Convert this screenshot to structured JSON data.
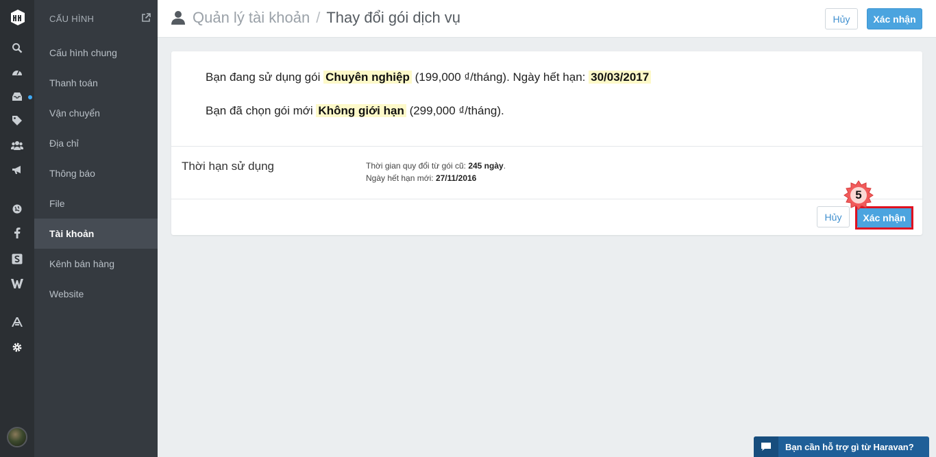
{
  "sidebar": {
    "header": "CẤU HÌNH",
    "items": [
      {
        "label": "Cấu hình chung"
      },
      {
        "label": "Thanh toán"
      },
      {
        "label": "Vận chuyển"
      },
      {
        "label": "Địa chỉ"
      },
      {
        "label": "Thông báo"
      },
      {
        "label": "File"
      },
      {
        "label": "Tài khoản",
        "active": true
      },
      {
        "label": "Kênh bán hàng"
      },
      {
        "label": "Website"
      }
    ]
  },
  "rail": {
    "icons": [
      "logo-icon",
      "search-icon",
      "dashboard-icon",
      "inbox-icon",
      "tags-icon",
      "users-icon",
      "megaphone-icon",
      "globe-icon",
      "facebook-icon",
      "s-app-icon",
      "w-app-icon",
      "apps-icon",
      "gear-icon"
    ]
  },
  "topbar": {
    "breadcrumb_parent": "Quản lý tài khoản",
    "breadcrumb_separator": "/",
    "breadcrumb_current": "Thay đổi gói dịch vụ",
    "cancel_label": "Hủy",
    "confirm_label": "Xác nhận"
  },
  "plan": {
    "current_prefix": "Bạn đang sử dụng gói",
    "current_name": "Chuyên nghiệp",
    "current_price": "(199,000 ₫/tháng). Ngày hết hạn:",
    "current_expiry": "30/03/2017",
    "new_prefix": "Bạn đã chọn gói mới",
    "new_name": "Không giới hạn",
    "new_price": "(299,000 ₫/tháng)."
  },
  "term": {
    "label": "Thời hạn sử dụng",
    "convert_prefix": "Thời gian quy đổi từ gói cũ:",
    "convert_value": "245 ngày",
    "convert_suffix": ".",
    "expiry_prefix": "Ngày hết hạn mới:",
    "expiry_value": "27/11/2016"
  },
  "footer": {
    "cancel_label": "Hủy",
    "confirm_label": "Xác nhận"
  },
  "step_marker": "5",
  "support": {
    "label": "Bạn cần hỗ trợ gì từ Haravan?"
  },
  "colors": {
    "accent": "#4ba4df",
    "sidebar": "#353a40",
    "rail": "#2b2f33",
    "highlight": "#fdf9c9",
    "step_outline": "#e0101f"
  }
}
